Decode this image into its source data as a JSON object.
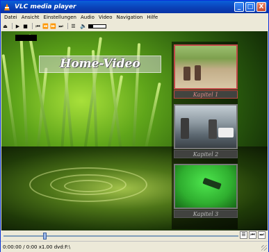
{
  "window": {
    "title": "VLC media player",
    "minimize_label": "_",
    "maximize_label": "□",
    "close_label": "X"
  },
  "menu": [
    "Datei",
    "Ansicht",
    "Einstellungen",
    "Audio",
    "Video",
    "Navigation",
    "Hilfe"
  ],
  "toolbar": {
    "eject_glyph": "⏏",
    "play_glyph": "▶",
    "stop_glyph": "■",
    "prev_glyph": "⏮",
    "rewind_glyph": "⏪",
    "forward_glyph": "⏩",
    "next_glyph": "⏭",
    "playlist_glyph": "☰",
    "volume_glyph": "🔈",
    "volume_level": 0.25
  },
  "video": {
    "menu_title": "Home-Video",
    "chapters": [
      {
        "label": "Kapitel 1",
        "selected": true
      },
      {
        "label": "Kapitel 2",
        "selected": false
      },
      {
        "label": "Kapitel 3",
        "selected": false
      }
    ]
  },
  "seek": {
    "position": 0.17,
    "btn_playlist": "☰",
    "btn_prev": "⏮",
    "btn_next": "⏭"
  },
  "status": {
    "text": "0:00:00 / 0:00 x1.00 dvd:F:\\"
  },
  "colors": {
    "titlebar": "#0a3fb5",
    "selection_border": "#c04848",
    "vlc_orange": "#ff8a00"
  }
}
